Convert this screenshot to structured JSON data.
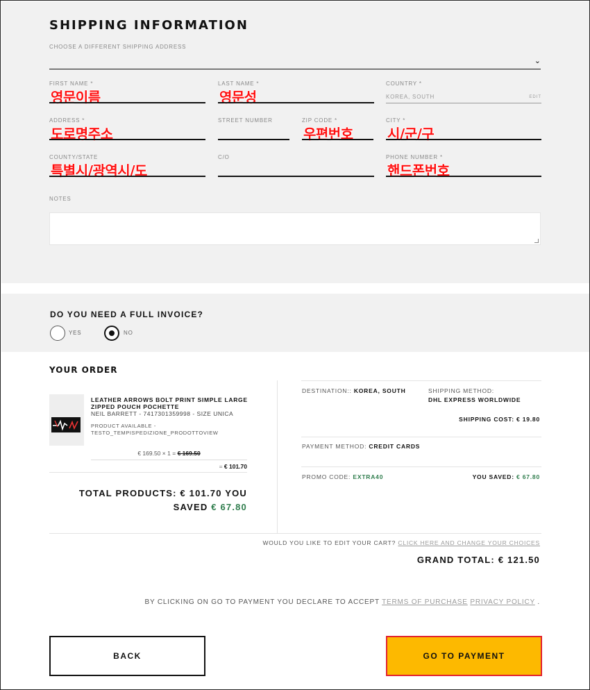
{
  "shipping": {
    "title": "SHIPPING INFORMATION",
    "choose_label": "CHOOSE A DIFFERENT SHIPPING ADDRESS",
    "chevron": "chevron-down-icon",
    "fields": {
      "first_name": {
        "label": "FIRST NAME *",
        "value": "영문이름"
      },
      "last_name": {
        "label": "LAST NAME *",
        "value": "영문성"
      },
      "country": {
        "label": "COUNTRY *",
        "value": "KOREA, SOUTH",
        "edit": "EDIT"
      },
      "address": {
        "label": "ADDRESS *",
        "value": "도로명주소"
      },
      "street_number": {
        "label": "STREET NUMBER",
        "value": ""
      },
      "zip": {
        "label": "ZIP CODE *",
        "value": "우편번호"
      },
      "city": {
        "label": "CITY *",
        "value": "시/군/구"
      },
      "county": {
        "label": "COUNTY/STATE",
        "value": "특별시/광역시/도"
      },
      "co": {
        "label": "C/O",
        "value": ""
      },
      "phone": {
        "label": "PHONE NUMBER *",
        "value": "핸드폰번호"
      }
    },
    "notes_label": "NOTES",
    "notes_value": ""
  },
  "invoice": {
    "question": "DO YOU NEED A FULL INVOICE?",
    "options": [
      {
        "label": "YES",
        "selected": false
      },
      {
        "label": "NO",
        "selected": true
      }
    ]
  },
  "order": {
    "title": "YOUR ORDER",
    "product": {
      "name": "LEATHER ARROWS BOLT PRINT SIMPLE LARGE ZIPPED POUCH POCHETTE",
      "brand_line": "NEIL BARRETT - 7417301359998 - SIZE UNICA",
      "availability": "PRODUCT AVAILABLE - TESTO_TEMPISPEDIZIONE_PRODOTTOVIEW",
      "unit_price": "€ 169.50",
      "times": "×",
      "qty": "1",
      "eq": "=",
      "old_price": "€ 169.50",
      "subtotal": "€ 101.70"
    },
    "total_products_label": "TOTAL PRODUCTS:",
    "total_products_value": "€ 101.70",
    "you_label": "YOU",
    "saved_label": "SAVED",
    "saved_value": "€ 67.80",
    "destination_label": "DESTINATION::",
    "destination_value": "KOREA, SOUTH",
    "shipping_method_label": "SHIPPING METHOD:",
    "shipping_method_value": "DHL EXPRESS WORLDWIDE",
    "shipping_cost_label": "SHIPPING COST:",
    "shipping_cost_value": "€ 19.80",
    "payment_method_label": "PAYMENT METHOD:",
    "payment_method_value": "CREDIT CARDS",
    "promo_label": "PROMO CODE:",
    "promo_value": "EXTRA40",
    "you_saved_label": "YOU SAVED:",
    "you_saved_value": "€ 67.80",
    "edit_cart_question": "WOULD YOU LIKE TO EDIT YOUR CART?",
    "edit_cart_link": "CLICK HERE AND CHANGE YOUR CHOICES",
    "grand_total_label": "GRAND TOTAL:",
    "grand_total_value": "€ 121.50"
  },
  "terms": {
    "text": "BY CLICKING ON GO TO PAYMENT YOU DECLARE TO ACCEPT",
    "terms_link": "TERMS OF PURCHASE",
    "privacy_link": "PRIVACY POLICY",
    "end": "."
  },
  "buttons": {
    "back": "BACK",
    "pay": "GO TO PAYMENT"
  },
  "colors": {
    "accent_yellow": "#fdb900",
    "highlight_red": "#e2222e",
    "saved_green": "#2f7d4d",
    "annotation_red": "#ff1010"
  }
}
